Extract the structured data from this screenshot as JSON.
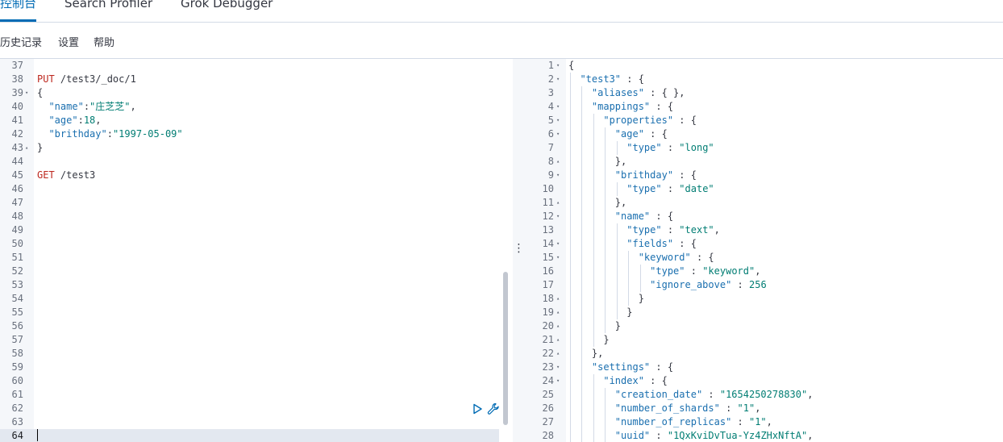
{
  "tabs": [
    {
      "label": "控制台",
      "active": true
    },
    {
      "label": "Search Profiler",
      "active": false
    },
    {
      "label": "Grok Debugger",
      "active": false
    }
  ],
  "menu": [
    "历史记录",
    "设置",
    "帮助"
  ],
  "colors": {
    "accent": "#006bb4",
    "method": "#bd271e",
    "key": "#1a6faf",
    "string": "#017d73"
  },
  "editor": {
    "lines": [
      {
        "n": "37",
        "fold": "",
        "tokens": []
      },
      {
        "n": "38",
        "fold": "",
        "tokens": [
          {
            "t": "method",
            "v": "PUT"
          },
          {
            "t": "url",
            "v": " /test3/_doc/1"
          }
        ]
      },
      {
        "n": "39",
        "fold": "▾",
        "tokens": [
          {
            "t": "punc",
            "v": "{"
          }
        ]
      },
      {
        "n": "40",
        "fold": "",
        "tokens": [
          {
            "t": "punc",
            "v": "  "
          },
          {
            "t": "key",
            "v": "\"name\""
          },
          {
            "t": "punc",
            "v": ":"
          },
          {
            "t": "str",
            "v": "\"庄芝芝\""
          },
          {
            "t": "punc",
            "v": ","
          }
        ]
      },
      {
        "n": "41",
        "fold": "",
        "tokens": [
          {
            "t": "punc",
            "v": "  "
          },
          {
            "t": "key",
            "v": "\"age\""
          },
          {
            "t": "punc",
            "v": ":"
          },
          {
            "t": "num",
            "v": "18"
          },
          {
            "t": "punc",
            "v": ","
          }
        ]
      },
      {
        "n": "42",
        "fold": "",
        "tokens": [
          {
            "t": "punc",
            "v": "  "
          },
          {
            "t": "key",
            "v": "\"brithday\""
          },
          {
            "t": "punc",
            "v": ":"
          },
          {
            "t": "str",
            "v": "\"1997-05-09\""
          }
        ]
      },
      {
        "n": "43",
        "fold": "▴",
        "tokens": [
          {
            "t": "punc",
            "v": "}"
          }
        ]
      },
      {
        "n": "44",
        "fold": "",
        "tokens": []
      },
      {
        "n": "45",
        "fold": "",
        "tokens": [
          {
            "t": "method",
            "v": "GET"
          },
          {
            "t": "url",
            "v": " /test3"
          }
        ]
      },
      {
        "n": "46",
        "fold": "",
        "tokens": []
      },
      {
        "n": "47",
        "fold": "",
        "tokens": []
      },
      {
        "n": "48",
        "fold": "",
        "tokens": []
      },
      {
        "n": "49",
        "fold": "",
        "tokens": []
      },
      {
        "n": "50",
        "fold": "",
        "tokens": []
      },
      {
        "n": "51",
        "fold": "",
        "tokens": []
      },
      {
        "n": "52",
        "fold": "",
        "tokens": []
      },
      {
        "n": "53",
        "fold": "",
        "tokens": []
      },
      {
        "n": "54",
        "fold": "",
        "tokens": []
      },
      {
        "n": "55",
        "fold": "",
        "tokens": []
      },
      {
        "n": "56",
        "fold": "",
        "tokens": []
      },
      {
        "n": "57",
        "fold": "",
        "tokens": []
      },
      {
        "n": "58",
        "fold": "",
        "tokens": []
      },
      {
        "n": "59",
        "fold": "",
        "tokens": []
      },
      {
        "n": "60",
        "fold": "",
        "tokens": []
      },
      {
        "n": "61",
        "fold": "",
        "tokens": []
      },
      {
        "n": "62",
        "fold": "",
        "tokens": []
      },
      {
        "n": "63",
        "fold": "",
        "tokens": []
      },
      {
        "n": "64",
        "fold": "",
        "tokens": [],
        "active": true
      }
    ]
  },
  "actions": [
    {
      "name": "play-icon",
      "label": "▷"
    },
    {
      "name": "wrench-icon",
      "label": "🔧"
    }
  ],
  "splitter_grip": "⋮",
  "output": {
    "lines": [
      {
        "n": "1",
        "fold": "▾",
        "tokens": [
          {
            "t": "punc",
            "v": "{"
          }
        ]
      },
      {
        "n": "2",
        "fold": "▾",
        "tokens": [
          {
            "t": "punc",
            "v": "  "
          },
          {
            "t": "key",
            "v": "\"test3\""
          },
          {
            "t": "punc",
            "v": " : {"
          }
        ]
      },
      {
        "n": "3",
        "fold": "",
        "tokens": [
          {
            "t": "punc",
            "v": "    "
          },
          {
            "t": "key",
            "v": "\"aliases\""
          },
          {
            "t": "punc",
            "v": " : { },"
          }
        ]
      },
      {
        "n": "4",
        "fold": "▾",
        "tokens": [
          {
            "t": "punc",
            "v": "    "
          },
          {
            "t": "key",
            "v": "\"mappings\""
          },
          {
            "t": "punc",
            "v": " : {"
          }
        ]
      },
      {
        "n": "5",
        "fold": "▾",
        "tokens": [
          {
            "t": "punc",
            "v": "      "
          },
          {
            "t": "key",
            "v": "\"properties\""
          },
          {
            "t": "punc",
            "v": " : {"
          }
        ]
      },
      {
        "n": "6",
        "fold": "▾",
        "tokens": [
          {
            "t": "punc",
            "v": "        "
          },
          {
            "t": "key",
            "v": "\"age\""
          },
          {
            "t": "punc",
            "v": " : {"
          }
        ]
      },
      {
        "n": "7",
        "fold": "",
        "tokens": [
          {
            "t": "punc",
            "v": "          "
          },
          {
            "t": "key",
            "v": "\"type\""
          },
          {
            "t": "punc",
            "v": " : "
          },
          {
            "t": "str",
            "v": "\"long\""
          }
        ]
      },
      {
        "n": "8",
        "fold": "▴",
        "tokens": [
          {
            "t": "punc",
            "v": "        },"
          }
        ]
      },
      {
        "n": "9",
        "fold": "▾",
        "tokens": [
          {
            "t": "punc",
            "v": "        "
          },
          {
            "t": "key",
            "v": "\"brithday\""
          },
          {
            "t": "punc",
            "v": " : {"
          }
        ]
      },
      {
        "n": "10",
        "fold": "",
        "tokens": [
          {
            "t": "punc",
            "v": "          "
          },
          {
            "t": "key",
            "v": "\"type\""
          },
          {
            "t": "punc",
            "v": " : "
          },
          {
            "t": "str",
            "v": "\"date\""
          }
        ]
      },
      {
        "n": "11",
        "fold": "▴",
        "tokens": [
          {
            "t": "punc",
            "v": "        },"
          }
        ]
      },
      {
        "n": "12",
        "fold": "▾",
        "tokens": [
          {
            "t": "punc",
            "v": "        "
          },
          {
            "t": "key",
            "v": "\"name\""
          },
          {
            "t": "punc",
            "v": " : {"
          }
        ]
      },
      {
        "n": "13",
        "fold": "",
        "tokens": [
          {
            "t": "punc",
            "v": "          "
          },
          {
            "t": "key",
            "v": "\"type\""
          },
          {
            "t": "punc",
            "v": " : "
          },
          {
            "t": "str",
            "v": "\"text\""
          },
          {
            "t": "punc",
            "v": ","
          }
        ]
      },
      {
        "n": "14",
        "fold": "▾",
        "tokens": [
          {
            "t": "punc",
            "v": "          "
          },
          {
            "t": "key",
            "v": "\"fields\""
          },
          {
            "t": "punc",
            "v": " : {"
          }
        ]
      },
      {
        "n": "15",
        "fold": "▾",
        "tokens": [
          {
            "t": "punc",
            "v": "            "
          },
          {
            "t": "key",
            "v": "\"keyword\""
          },
          {
            "t": "punc",
            "v": " : {"
          }
        ]
      },
      {
        "n": "16",
        "fold": "",
        "tokens": [
          {
            "t": "punc",
            "v": "              "
          },
          {
            "t": "key",
            "v": "\"type\""
          },
          {
            "t": "punc",
            "v": " : "
          },
          {
            "t": "str",
            "v": "\"keyword\""
          },
          {
            "t": "punc",
            "v": ","
          }
        ]
      },
      {
        "n": "17",
        "fold": "",
        "tokens": [
          {
            "t": "punc",
            "v": "              "
          },
          {
            "t": "key",
            "v": "\"ignore_above\""
          },
          {
            "t": "punc",
            "v": " : "
          },
          {
            "t": "num",
            "v": "256"
          }
        ]
      },
      {
        "n": "18",
        "fold": "▴",
        "tokens": [
          {
            "t": "punc",
            "v": "            }"
          }
        ]
      },
      {
        "n": "19",
        "fold": "▴",
        "tokens": [
          {
            "t": "punc",
            "v": "          }"
          }
        ]
      },
      {
        "n": "20",
        "fold": "▴",
        "tokens": [
          {
            "t": "punc",
            "v": "        }"
          }
        ]
      },
      {
        "n": "21",
        "fold": "▴",
        "tokens": [
          {
            "t": "punc",
            "v": "      }"
          }
        ]
      },
      {
        "n": "22",
        "fold": "▴",
        "tokens": [
          {
            "t": "punc",
            "v": "    },"
          }
        ]
      },
      {
        "n": "23",
        "fold": "▾",
        "tokens": [
          {
            "t": "punc",
            "v": "    "
          },
          {
            "t": "key",
            "v": "\"settings\""
          },
          {
            "t": "punc",
            "v": " : {"
          }
        ]
      },
      {
        "n": "24",
        "fold": "▾",
        "tokens": [
          {
            "t": "punc",
            "v": "      "
          },
          {
            "t": "key",
            "v": "\"index\""
          },
          {
            "t": "punc",
            "v": " : {"
          }
        ]
      },
      {
        "n": "25",
        "fold": "",
        "tokens": [
          {
            "t": "punc",
            "v": "        "
          },
          {
            "t": "key",
            "v": "\"creation_date\""
          },
          {
            "t": "punc",
            "v": " : "
          },
          {
            "t": "str",
            "v": "\"1654250278830\""
          },
          {
            "t": "punc",
            "v": ","
          }
        ]
      },
      {
        "n": "26",
        "fold": "",
        "tokens": [
          {
            "t": "punc",
            "v": "        "
          },
          {
            "t": "key",
            "v": "\"number_of_shards\""
          },
          {
            "t": "punc",
            "v": " : "
          },
          {
            "t": "str",
            "v": "\"1\""
          },
          {
            "t": "punc",
            "v": ","
          }
        ]
      },
      {
        "n": "27",
        "fold": "",
        "tokens": [
          {
            "t": "punc",
            "v": "        "
          },
          {
            "t": "key",
            "v": "\"number_of_replicas\""
          },
          {
            "t": "punc",
            "v": " : "
          },
          {
            "t": "str",
            "v": "\"1\""
          },
          {
            "t": "punc",
            "v": ","
          }
        ]
      },
      {
        "n": "28",
        "fold": "",
        "tokens": [
          {
            "t": "punc",
            "v": "        "
          },
          {
            "t": "key",
            "v": "\"uuid\""
          },
          {
            "t": "punc",
            "v": " : "
          },
          {
            "t": "str",
            "v": "\"1QxKviDvTua-Yz4ZHxNftA\""
          },
          {
            "t": "punc",
            "v": ","
          }
        ]
      }
    ]
  }
}
